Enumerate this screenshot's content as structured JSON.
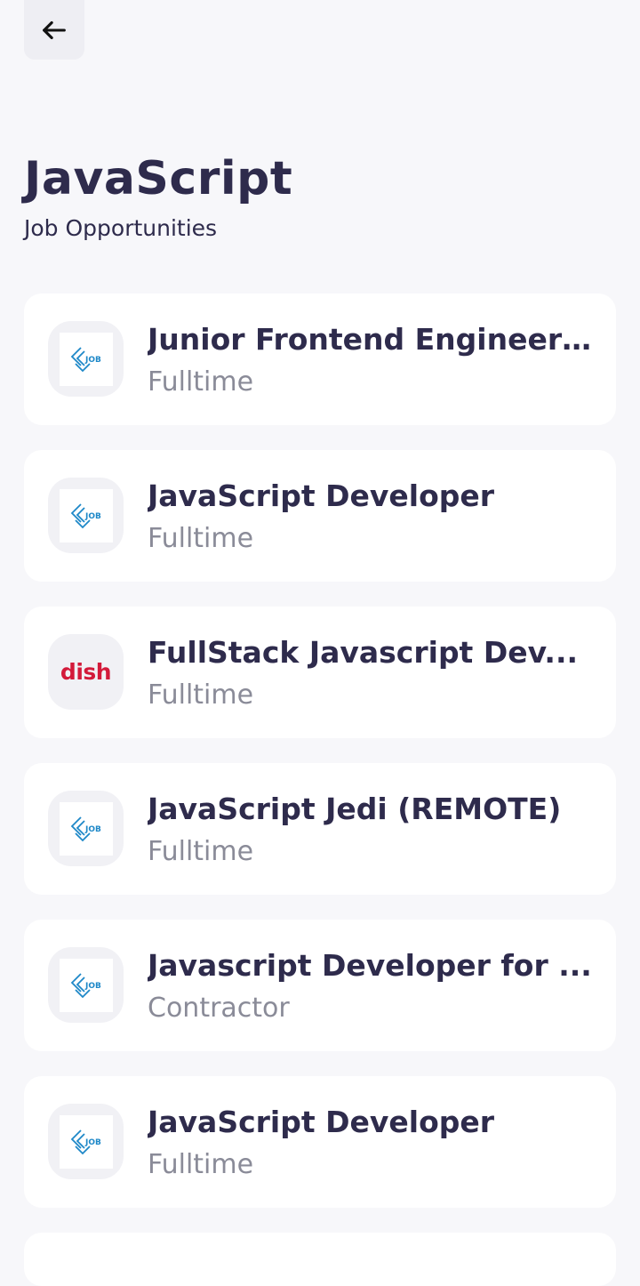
{
  "header": {
    "back_icon": "arrow-left-icon",
    "title": "JavaScript",
    "subtitle": "Job Opportunities"
  },
  "colors": {
    "background": "#F7F7FA",
    "card": "#FFFFFF",
    "title_text": "#2E2B4C",
    "secondary_text": "#8A8B98",
    "job_logo_blue": "#1E88C8",
    "dish_red": "#D31A3A"
  },
  "jobs": [
    {
      "title": "Junior Frontend Engineer ..",
      "type": "Fulltime",
      "logo": "job-logo-icon"
    },
    {
      "title": "JavaScript Developer",
      "type": "Fulltime",
      "logo": "job-logo-icon"
    },
    {
      "title": "FullStack Javascript Dev...",
      "type": "Fulltime",
      "logo": "dish-logo",
      "logo_text": "dish"
    },
    {
      "title": "JavaScript Jedi (REMOTE)",
      "type": "Fulltime",
      "logo": "job-logo-icon"
    },
    {
      "title": "Javascript Developer for ...",
      "type": "Contractor",
      "logo": "job-logo-icon"
    },
    {
      "title": "JavaScript Developer",
      "type": "Fulltime",
      "logo": "job-logo-icon"
    }
  ]
}
